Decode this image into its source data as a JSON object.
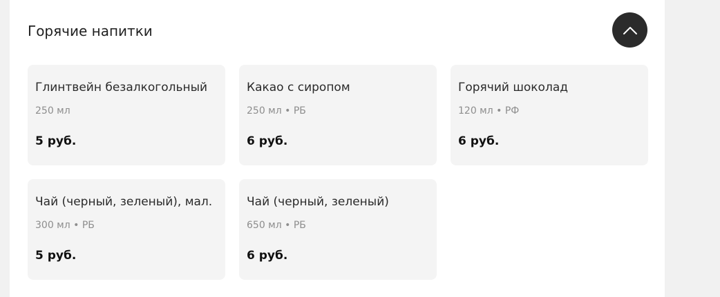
{
  "section": {
    "title": "Горячие напитки"
  },
  "collapse_button": {
    "icon": "chevron-up-icon"
  },
  "items": [
    {
      "name": "Глинтвейн безалкогольный",
      "meta": "250 мл",
      "price": "5 руб."
    },
    {
      "name": "Какао с сиропом",
      "meta": "250 мл • РБ",
      "price": "6 руб."
    },
    {
      "name": "Горячий шоколад",
      "meta": "120 мл • РФ",
      "price": "6 руб."
    },
    {
      "name": "Чай (черный, зеленый), мал.",
      "meta": "300 мл • РБ",
      "price": "5 руб."
    },
    {
      "name": "Чай (черный, зеленый)",
      "meta": "650 мл • РБ",
      "price": "6 руб."
    }
  ],
  "colors": {
    "page_background": "#f1f1f1",
    "panel_background": "#ffffff",
    "card_background": "#f4f4f4",
    "button_background": "#2b2b2b",
    "meta_text": "#8d8d8d"
  }
}
